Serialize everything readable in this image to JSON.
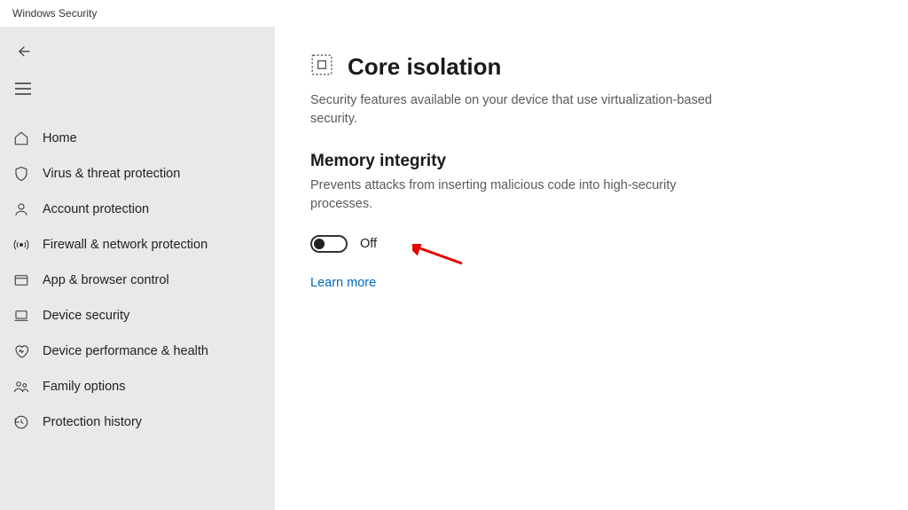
{
  "window": {
    "title": "Windows Security"
  },
  "sidebar": {
    "items": [
      {
        "id": "home",
        "label": "Home"
      },
      {
        "id": "virus",
        "label": "Virus & threat protection"
      },
      {
        "id": "account",
        "label": "Account protection"
      },
      {
        "id": "firewall",
        "label": "Firewall & network protection"
      },
      {
        "id": "appbrowser",
        "label": "App & browser control"
      },
      {
        "id": "device",
        "label": "Device security"
      },
      {
        "id": "performance",
        "label": "Device performance & health"
      },
      {
        "id": "family",
        "label": "Family options"
      },
      {
        "id": "history",
        "label": "Protection history"
      }
    ]
  },
  "main": {
    "title": "Core isolation",
    "description": "Security features available on your device that use virtualization-based security.",
    "section": {
      "title": "Memory integrity",
      "description": "Prevents attacks from inserting malicious code into high-security processes.",
      "toggle_state": "Off"
    },
    "learn_more": "Learn more"
  },
  "colors": {
    "link": "#0067c0",
    "sidebar_bg": "#e9e9e9",
    "arrow": "#e80000"
  }
}
